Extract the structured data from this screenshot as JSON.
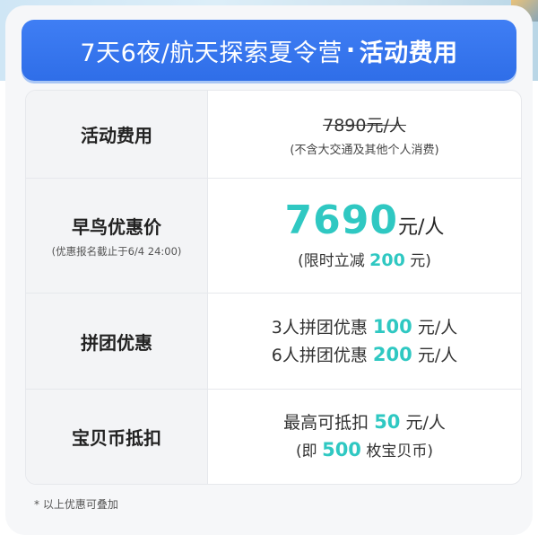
{
  "header": {
    "title": "7天6夜/航天探索夏令营",
    "separator": "·",
    "subtitle": "活动费用"
  },
  "rows": [
    {
      "label": "活动费用",
      "original_price": "7890元/人",
      "note": "(不含大交通及其他个人消费)"
    },
    {
      "label": "早鸟优惠价",
      "sublabel": "(优惠报名截止于6/4 24:00)",
      "price": "7690",
      "unit": "元/人",
      "discount_prefix": "(限时立减",
      "discount_amount": "200",
      "discount_suffix": "元)"
    },
    {
      "label": "拼团优惠",
      "lines": [
        {
          "prefix": "3人拼团优惠",
          "amount": "100",
          "suffix": "元/人"
        },
        {
          "prefix": "6人拼团优惠",
          "amount": "200",
          "suffix": "元/人"
        }
      ]
    },
    {
      "label": "宝贝币抵扣",
      "line1": {
        "prefix": "最高可抵扣",
        "amount": "50",
        "suffix": "元/人"
      },
      "line2": {
        "prefix": "(即",
        "amount": "500",
        "suffix": "枚宝贝币)"
      }
    }
  ],
  "footnote": "* 以上优惠可叠加",
  "colors": {
    "title_bar": "#2f6ee8",
    "accent": "#2fc8c2"
  }
}
